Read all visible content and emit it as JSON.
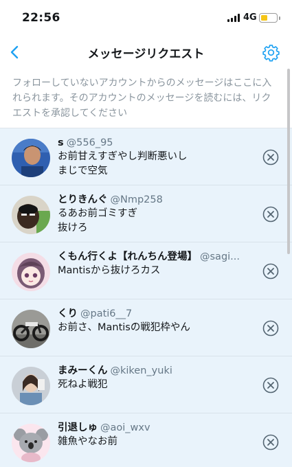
{
  "status_bar": {
    "time": "22:56",
    "network": "4G"
  },
  "header": {
    "title": "メッセージリクエスト"
  },
  "info_text": "フォローしていないアカウントからのメッセージはここに入れられます。そのアカウントのメッセージを読むには、リクエストを承認してください",
  "requests": [
    {
      "name": "s",
      "handle": "@556_95",
      "lines": [
        "お前甘えすぎやし判断悪いし",
        "まじで空気"
      ]
    },
    {
      "name": "とりきんぐ",
      "handle": "@Nmp258",
      "lines": [
        "るあお前ゴミすぎ",
        "抜けろ"
      ]
    },
    {
      "name": "くもん行くよ【れんちん登場】",
      "handle": "@sagi...",
      "lines": [
        "Mantisから抜けろカス"
      ]
    },
    {
      "name": "くり",
      "handle": "@pati6__7",
      "lines": [
        "お前さ、Mantisの戦犯枠やん"
      ]
    },
    {
      "name": "まみーくん",
      "handle": "@kiken_yuki",
      "lines": [
        "死ねよ戦犯"
      ]
    },
    {
      "name": "引退しゅ",
      "handle": "@aoi_wxv",
      "lines": [
        "雑魚やなお前"
      ]
    }
  ],
  "colors": {
    "accent": "#1da1f2",
    "row_background": "#e9f3fb",
    "secondary_text": "#8a959e",
    "battery": "#f5c518"
  },
  "icons": {
    "back": "chevron-left-icon",
    "settings": "gear-icon",
    "dismiss": "close-circle-icon"
  }
}
